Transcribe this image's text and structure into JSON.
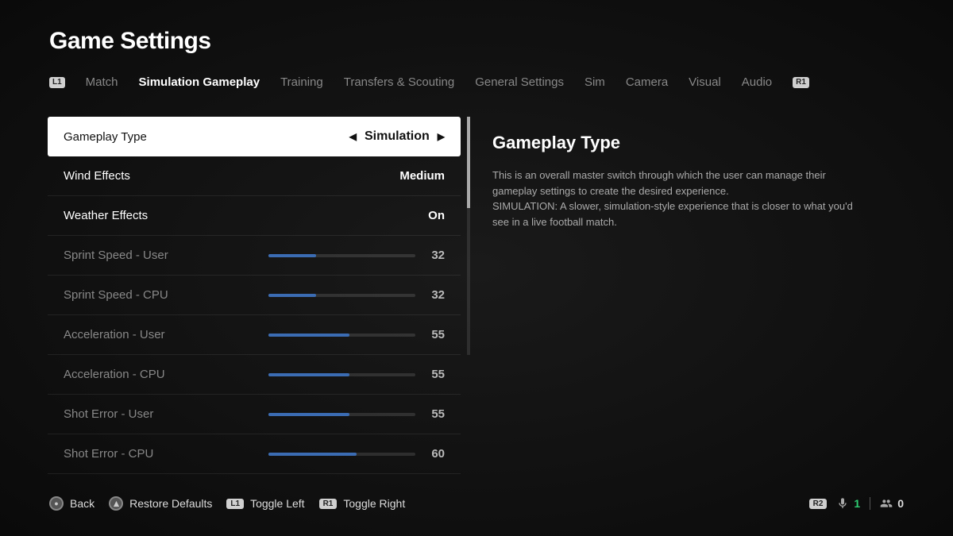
{
  "title": "Game Settings",
  "bumpers": {
    "left": "L1",
    "right": "R1"
  },
  "tabs": [
    {
      "label": "Match"
    },
    {
      "label": "Simulation Gameplay",
      "active": true
    },
    {
      "label": "Training"
    },
    {
      "label": "Transfers & Scouting"
    },
    {
      "label": "General Settings"
    },
    {
      "label": "Sim"
    },
    {
      "label": "Camera"
    },
    {
      "label": "Visual"
    },
    {
      "label": "Audio"
    }
  ],
  "settings": [
    {
      "label": "Gameplay Type",
      "type": "selector",
      "value": "Simulation",
      "selected": true
    },
    {
      "label": "Wind Effects",
      "type": "text",
      "value": "Medium"
    },
    {
      "label": "Weather Effects",
      "type": "text",
      "value": "On"
    },
    {
      "label": "Sprint Speed - User",
      "type": "slider",
      "value": 32,
      "dim": true
    },
    {
      "label": "Sprint Speed - CPU",
      "type": "slider",
      "value": 32,
      "dim": true
    },
    {
      "label": "Acceleration - User",
      "type": "slider",
      "value": 55,
      "dim": true
    },
    {
      "label": "Acceleration - CPU",
      "type": "slider",
      "value": 55,
      "dim": true
    },
    {
      "label": "Shot Error - User",
      "type": "slider",
      "value": 55,
      "dim": true
    },
    {
      "label": "Shot Error - CPU",
      "type": "slider",
      "value": 60,
      "dim": true
    }
  ],
  "info": {
    "title": "Gameplay Type",
    "body": "This is an overall master switch through which the user can manage their gameplay settings to create the desired experience.\nSIMULATION: A slower, simulation-style experience that is closer to what you'd see in a live football match."
  },
  "footer": {
    "back": "Back",
    "restore": "Restore Defaults",
    "toggleLeft": "Toggle Left",
    "toggleRight": "Toggle Right",
    "keyL": "L1",
    "keyR": "R1",
    "r2": "R2",
    "voiceCount": "1",
    "partyCount": "0"
  }
}
